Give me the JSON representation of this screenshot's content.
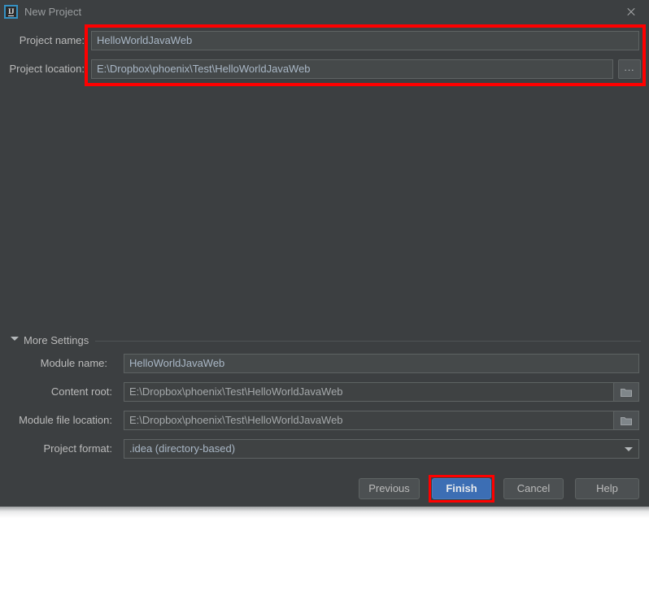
{
  "window": {
    "title": "New Project",
    "app_icon": "intellij-idea-icon",
    "icon_text": "IJ",
    "close_icon": "close-icon"
  },
  "top_fields": [
    {
      "label": "Project name:",
      "value": "HelloWorldJavaWeb",
      "name": "project-name"
    },
    {
      "label": "Project location:",
      "value": "E:\\Dropbox\\phoenix\\Test\\HelloWorldJavaWeb",
      "name": "project-location",
      "browse_label": "..."
    }
  ],
  "more_settings": {
    "label": "More Settings",
    "expanded": true,
    "toggle_icon": "chevron-down-icon"
  },
  "settings_fields": [
    {
      "label": "Module name:",
      "value": "HelloWorldJavaWeb",
      "name": "module-name",
      "control": "text"
    },
    {
      "label": "Content root:",
      "value": "E:\\Dropbox\\phoenix\\Test\\HelloWorldJavaWeb",
      "name": "content-root",
      "control": "folder"
    },
    {
      "label": "Module file location:",
      "value": "E:\\Dropbox\\phoenix\\Test\\HelloWorldJavaWeb",
      "name": "module-file-location",
      "control": "folder"
    },
    {
      "label": "Project format:",
      "value": ".idea (directory-based)",
      "name": "project-format",
      "control": "combo"
    }
  ],
  "buttons": {
    "previous": "Previous",
    "finish": "Finish",
    "cancel": "Cancel",
    "help": "Help"
  },
  "annotations": {
    "color": "#ff0000",
    "highlights": [
      "top-fields-group",
      "finish-button"
    ]
  },
  "colors": {
    "dialog_background": "#3c3f41",
    "field_background": "#45494a",
    "field_border": "#5e6363",
    "text": "#bbbbbb",
    "value_text": "#a9b7c6",
    "primary_button": "#3c6eb4",
    "accent_icon_border": "#3592c4",
    "annotation": "#ff0000"
  }
}
